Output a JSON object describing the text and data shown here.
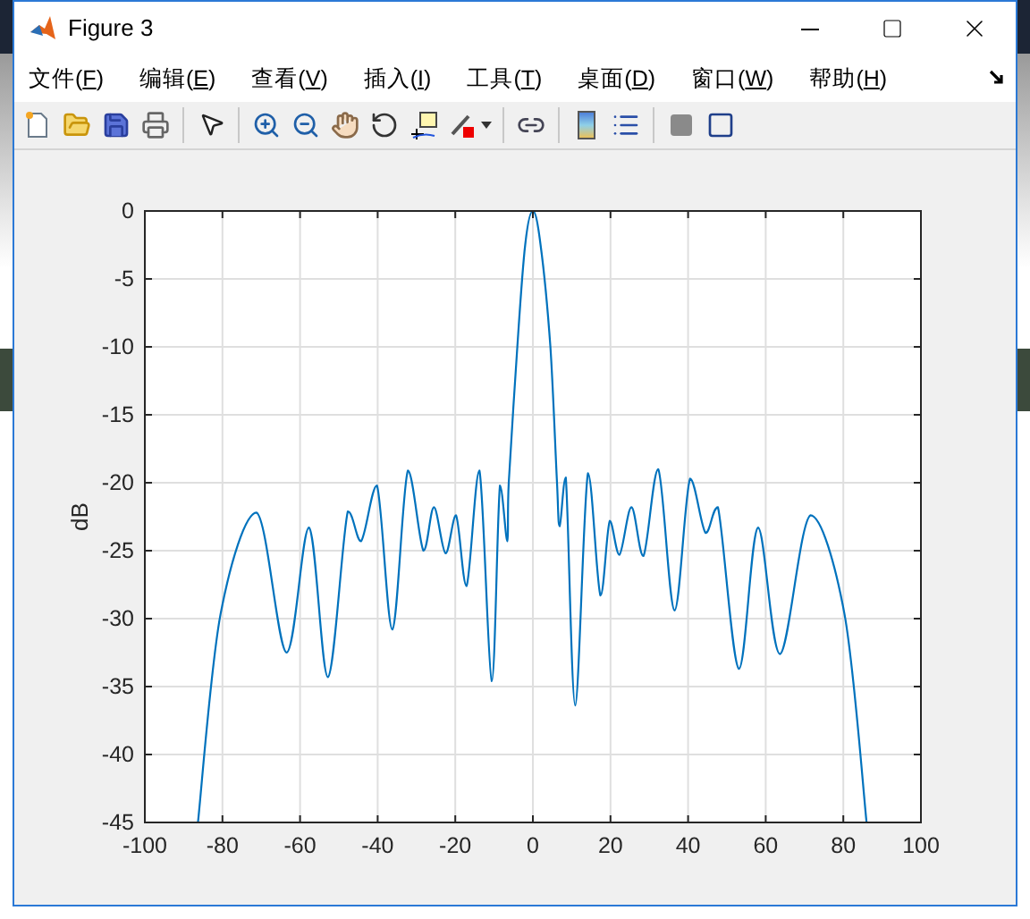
{
  "window": {
    "title": "Figure 3"
  },
  "menu": [
    {
      "before": "文件(",
      "hotkey": "F",
      "after": ")"
    },
    {
      "before": "编辑(",
      "hotkey": "E",
      "after": ")"
    },
    {
      "before": "查看(",
      "hotkey": "V",
      "after": ")"
    },
    {
      "before": "插入(",
      "hotkey": "I",
      "after": ")"
    },
    {
      "before": "工具(",
      "hotkey": "T",
      "after": ")"
    },
    {
      "before": "桌面(",
      "hotkey": "D",
      "after": ")"
    },
    {
      "before": "窗口(",
      "hotkey": "W",
      "after": ")"
    },
    {
      "before": "帮助(",
      "hotkey": "H",
      "after": ")"
    }
  ],
  "chart_data": {
    "type": "line",
    "grid": true,
    "ylabel": "dB",
    "xlim": [
      -100,
      100
    ],
    "ylim": [
      -45,
      0
    ],
    "xticks": [
      -100,
      -80,
      -60,
      -40,
      -20,
      0,
      20,
      40,
      60,
      80,
      100
    ],
    "yticks": [
      0,
      -5,
      -10,
      -15,
      -20,
      -25,
      -30,
      -35,
      -40,
      -45
    ],
    "x": [
      -86.3,
      -80.5,
      -71.2,
      -63.5,
      -57.7,
      -52.8,
      -47.7,
      -44.3,
      -40.2,
      -36.2,
      -32.2,
      -28.2,
      -25.5,
      -22.5,
      -19.8,
      -17.1,
      -13.8,
      -10.6,
      -8.5,
      -6.6,
      -6.2,
      -4,
      -2,
      0,
      2,
      4.5,
      6.2,
      6.9,
      8.5,
      10.9,
      14.2,
      17.4,
      19.8,
      22.3,
      25.4,
      28.5,
      32.3,
      36.5,
      40.5,
      44.5,
      47.7,
      53.1,
      58,
      63.7,
      71.5,
      80.3,
      86
    ],
    "series": [
      {
        "color": "#0072bd",
        "values": [
          -45,
          -29.7,
          -22.2,
          -32.5,
          -23.3,
          -34.3,
          -22.1,
          -24.3,
          -20.2,
          -30.8,
          -19.1,
          -25,
          -21.8,
          -25.2,
          -22.4,
          -27.6,
          -19.1,
          -34.6,
          -20.2,
          -24.3,
          -20,
          -10,
          -2.5,
          0,
          -2.5,
          -10,
          -20,
          -23.2,
          -19.6,
          -36.4,
          -19.3,
          -28.3,
          -22.8,
          -25.3,
          -21.8,
          -25.4,
          -19,
          -29.4,
          -19.7,
          -23.7,
          -21.8,
          -33.7,
          -23.3,
          -32.6,
          -22.4,
          -29.7,
          -45
        ]
      }
    ]
  }
}
